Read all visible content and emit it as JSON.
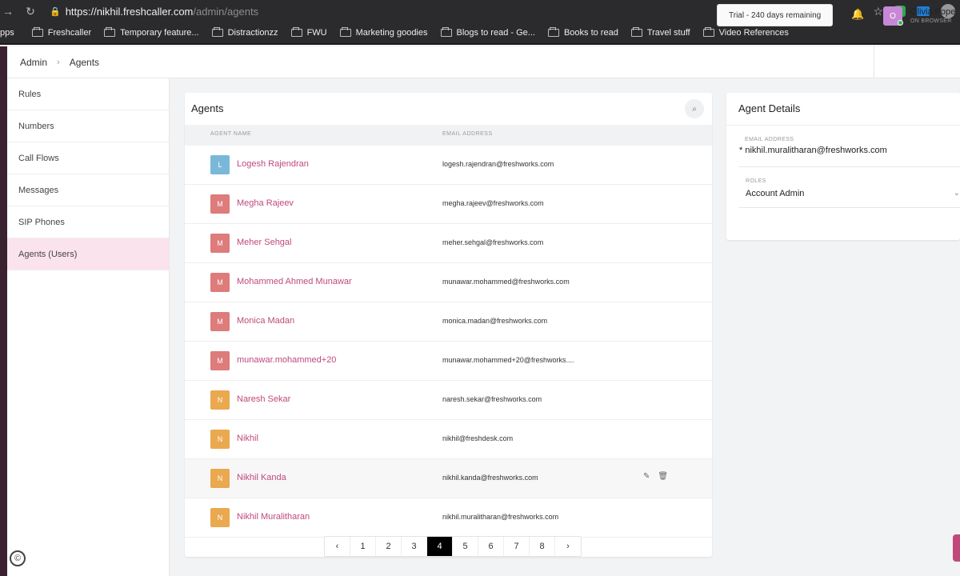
{
  "browser": {
    "url_host": "https://nikhil.freshcaller.com",
    "url_path": "/admin/agents",
    "bookmarks": [
      "pps",
      "Freshcaller",
      "Temporary feature...",
      "Distractionzz",
      "FWU",
      "Marketing goodies",
      "Blogs to read - Ge...",
      "Books to read",
      "Travel stuff",
      "Video References"
    ]
  },
  "header": {
    "breadcrumb": [
      "Admin",
      "Agents"
    ],
    "trial": "Trial - 240 days remaining",
    "user_name": "Olivia Pope",
    "user_initial": "O",
    "user_status": "ON BROWSER"
  },
  "sidebar": {
    "items": [
      "Rules",
      "Numbers",
      "Call Flows",
      "Messages",
      "SIP Phones",
      "Agents (Users)"
    ],
    "active_index": 5
  },
  "agents": {
    "title": "Agents",
    "columns": [
      "AGENT NAME",
      "EMAIL ADDRESS"
    ],
    "rows": [
      {
        "initial": "L",
        "name": "Logesh Rajendran",
        "email": "logesh.rajendran@freshworks.com",
        "color": "#7ab8d9"
      },
      {
        "initial": "M",
        "name": "Megha Rajeev",
        "email": "megha.rajeev@freshworks.com",
        "color": "#de7b7b"
      },
      {
        "initial": "M",
        "name": "Meher Sehgal",
        "email": "meher.sehgal@freshworks.com",
        "color": "#de7b7b"
      },
      {
        "initial": "M",
        "name": "Mohammed Ahmed Munawar",
        "email": "munawar.mohammed@freshworks.com",
        "color": "#de7b7b"
      },
      {
        "initial": "M",
        "name": "Monica Madan",
        "email": "monica.madan@freshworks.com",
        "color": "#de7b7b"
      },
      {
        "initial": "M",
        "name": "munawar.mohammed+20",
        "email": "munawar.mohammed+20@freshworks....",
        "color": "#de7b7b"
      },
      {
        "initial": "N",
        "name": "Naresh Sekar",
        "email": "naresh.sekar@freshworks.com",
        "color": "#eaa84f"
      },
      {
        "initial": "N",
        "name": "Nikhil",
        "email": "nikhil@freshdesk.com",
        "color": "#eaa84f"
      },
      {
        "initial": "N",
        "name": "Nikhil Kanda",
        "email": "nikhil.kanda@freshworks.com",
        "color": "#eaa84f"
      },
      {
        "initial": "N",
        "name": "Nikhil Muralitharan",
        "email": "nikhil.muralitharan@freshworks.com",
        "color": "#eaa84f"
      }
    ],
    "hover_row_index": 8,
    "pagination": {
      "prev": "‹",
      "pages": [
        "1",
        "2",
        "3",
        "4",
        "5",
        "6",
        "7",
        "8"
      ],
      "current": "4",
      "next": "›"
    }
  },
  "details": {
    "title": "Agent Details",
    "email_label": "EMAIL ADDRESS",
    "email_value": "* nikhil.muralitharan@freshworks.com",
    "roles_label": "ROLES",
    "roles_value": "Account Admin"
  },
  "icons": {
    "back": "arrow-right-icon",
    "reload": "reload-icon",
    "lock": "lock-icon",
    "search": "search-icon",
    "bell": "bell-icon",
    "edit": "pencil-icon",
    "delete": "trash-icon",
    "help": "help-icon"
  },
  "colors": {
    "accent": "#c0497a",
    "sidebar_active": "#fbe3ee"
  }
}
